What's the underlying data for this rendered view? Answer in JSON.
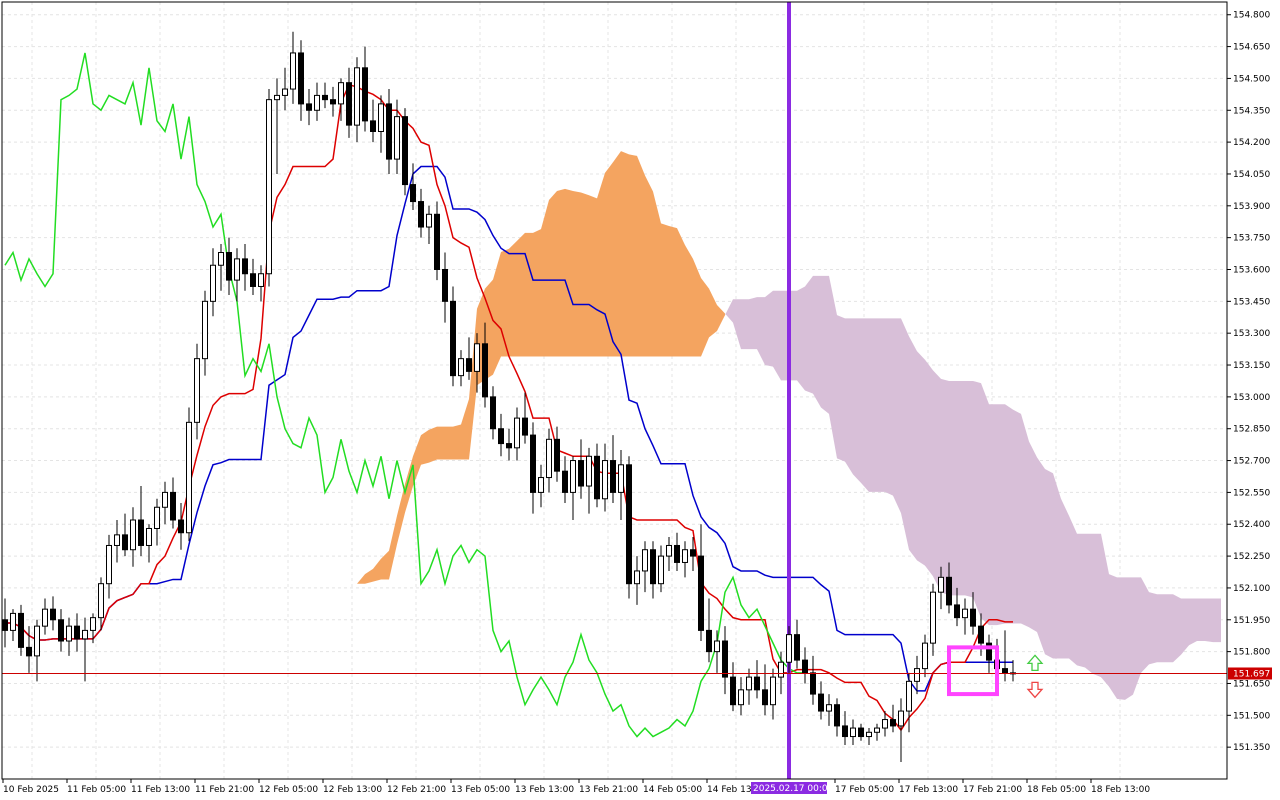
{
  "chart_data": {
    "type": "candlestick",
    "instrument_note": "",
    "y_axis": {
      "range": [
        151.2,
        154.86
      ],
      "ticks": [
        "154.800",
        "154.650",
        "154.500",
        "154.350",
        "154.200",
        "154.050",
        "153.900",
        "153.750",
        "153.600",
        "153.450",
        "153.300",
        "153.150",
        "153.000",
        "152.850",
        "152.700",
        "152.550",
        "152.400",
        "152.250",
        "152.100",
        "151.950",
        "151.800",
        "151.650",
        "151.500",
        "151.350"
      ]
    },
    "x_axis": {
      "labels": [
        "10 Feb 2025",
        "11 Feb 05:00",
        "11 Feb 13:00",
        "11 Feb 21:00",
        "12 Feb 05:00",
        "12 Feb 13:00",
        "12 Feb 21:00",
        "13 Feb 05:00",
        "13 Feb 13:00",
        "13 Feb 21:00",
        "14 Feb 05:00",
        "14 Feb 13:00",
        "17 Feb 05:00",
        "17 Feb 13:00",
        "17 Feb 21:00",
        "18 Feb 05:00",
        "18 Feb 13:00"
      ],
      "highlight_label": "2025.02.17 00:00"
    },
    "current_price": "151.697",
    "current_price_value": 151.697,
    "grid": true,
    "candles": [
      {
        "o": 151.95,
        "h": 152.05,
        "l": 151.82,
        "c": 151.9
      },
      {
        "o": 151.9,
        "h": 152.0,
        "l": 151.85,
        "c": 151.98
      },
      {
        "o": 151.98,
        "h": 152.02,
        "l": 151.78,
        "c": 151.82
      },
      {
        "o": 151.82,
        "h": 151.92,
        "l": 151.7,
        "c": 151.78
      },
      {
        "o": 151.78,
        "h": 151.95,
        "l": 151.66,
        "c": 151.92
      },
      {
        "o": 151.92,
        "h": 152.05,
        "l": 151.88,
        "c": 152.0
      },
      {
        "o": 152.0,
        "h": 152.06,
        "l": 151.9,
        "c": 151.95
      },
      {
        "o": 151.95,
        "h": 152.0,
        "l": 151.8,
        "c": 151.85
      },
      {
        "o": 151.85,
        "h": 151.96,
        "l": 151.78,
        "c": 151.92
      },
      {
        "o": 151.92,
        "h": 151.98,
        "l": 151.8,
        "c": 151.86
      },
      {
        "o": 151.86,
        "h": 151.96,
        "l": 151.66,
        "c": 151.9
      },
      {
        "o": 151.9,
        "h": 151.98,
        "l": 151.84,
        "c": 151.96
      },
      {
        "o": 151.96,
        "h": 152.15,
        "l": 151.9,
        "c": 152.12
      },
      {
        "o": 152.12,
        "h": 152.35,
        "l": 152.05,
        "c": 152.3
      },
      {
        "o": 152.3,
        "h": 152.42,
        "l": 152.22,
        "c": 152.35
      },
      {
        "o": 152.35,
        "h": 152.45,
        "l": 152.25,
        "c": 152.28
      },
      {
        "o": 152.28,
        "h": 152.48,
        "l": 152.2,
        "c": 152.42
      },
      {
        "o": 152.42,
        "h": 152.58,
        "l": 152.25,
        "c": 152.3
      },
      {
        "o": 152.3,
        "h": 152.4,
        "l": 152.22,
        "c": 152.38
      },
      {
        "o": 152.38,
        "h": 152.52,
        "l": 152.3,
        "c": 152.48
      },
      {
        "o": 152.48,
        "h": 152.6,
        "l": 152.4,
        "c": 152.55
      },
      {
        "o": 152.55,
        "h": 152.62,
        "l": 152.38,
        "c": 152.42
      },
      {
        "o": 152.42,
        "h": 152.5,
        "l": 152.28,
        "c": 152.36
      },
      {
        "o": 152.36,
        "h": 152.95,
        "l": 152.32,
        "c": 152.88
      },
      {
        "o": 152.88,
        "h": 153.25,
        "l": 152.8,
        "c": 153.18
      },
      {
        "o": 153.18,
        "h": 153.5,
        "l": 153.1,
        "c": 153.45
      },
      {
        "o": 153.45,
        "h": 153.7,
        "l": 153.38,
        "c": 153.62
      },
      {
        "o": 153.62,
        "h": 153.72,
        "l": 153.5,
        "c": 153.68
      },
      {
        "o": 153.68,
        "h": 153.75,
        "l": 153.48,
        "c": 153.55
      },
      {
        "o": 153.55,
        "h": 153.7,
        "l": 153.45,
        "c": 153.65
      },
      {
        "o": 153.65,
        "h": 153.72,
        "l": 153.5,
        "c": 153.58
      },
      {
        "o": 153.58,
        "h": 153.65,
        "l": 153.48,
        "c": 153.52
      },
      {
        "o": 153.52,
        "h": 153.62,
        "l": 153.45,
        "c": 153.58
      },
      {
        "o": 153.58,
        "h": 154.45,
        "l": 153.52,
        "c": 154.4
      },
      {
        "o": 154.4,
        "h": 154.5,
        "l": 154.05,
        "c": 154.42
      },
      {
        "o": 154.42,
        "h": 154.55,
        "l": 154.35,
        "c": 154.45
      },
      {
        "o": 154.45,
        "h": 154.72,
        "l": 154.38,
        "c": 154.62
      },
      {
        "o": 154.62,
        "h": 154.68,
        "l": 154.3,
        "c": 154.38
      },
      {
        "o": 154.38,
        "h": 154.45,
        "l": 154.28,
        "c": 154.35
      },
      {
        "o": 154.35,
        "h": 154.48,
        "l": 154.3,
        "c": 154.42
      },
      {
        "o": 154.42,
        "h": 154.48,
        "l": 154.36,
        "c": 154.4
      },
      {
        "o": 154.4,
        "h": 154.46,
        "l": 154.32,
        "c": 154.38
      },
      {
        "o": 154.38,
        "h": 154.5,
        "l": 154.3,
        "c": 154.48
      },
      {
        "o": 154.48,
        "h": 154.55,
        "l": 154.22,
        "c": 154.28
      },
      {
        "o": 154.28,
        "h": 154.6,
        "l": 154.2,
        "c": 154.55
      },
      {
        "o": 154.55,
        "h": 154.65,
        "l": 154.25,
        "c": 154.3
      },
      {
        "o": 154.3,
        "h": 154.4,
        "l": 154.2,
        "c": 154.25
      },
      {
        "o": 154.25,
        "h": 154.42,
        "l": 154.15,
        "c": 154.38
      },
      {
        "o": 154.38,
        "h": 154.45,
        "l": 154.05,
        "c": 154.12
      },
      {
        "o": 154.12,
        "h": 154.4,
        "l": 154.05,
        "c": 154.32
      },
      {
        "o": 154.32,
        "h": 154.36,
        "l": 153.95,
        "c": 154.0
      },
      {
        "o": 154.0,
        "h": 154.1,
        "l": 153.88,
        "c": 153.92
      },
      {
        "o": 153.92,
        "h": 153.98,
        "l": 153.75,
        "c": 153.8
      },
      {
        "o": 153.8,
        "h": 153.9,
        "l": 153.72,
        "c": 153.86
      },
      {
        "o": 153.86,
        "h": 153.92,
        "l": 153.55,
        "c": 153.6
      },
      {
        "o": 153.6,
        "h": 153.68,
        "l": 153.35,
        "c": 153.45
      },
      {
        "o": 153.45,
        "h": 153.52,
        "l": 153.05,
        "c": 153.1
      },
      {
        "o": 153.1,
        "h": 153.22,
        "l": 153.05,
        "c": 153.18
      },
      {
        "o": 153.18,
        "h": 153.28,
        "l": 153.08,
        "c": 153.12
      },
      {
        "o": 153.12,
        "h": 153.3,
        "l": 153.02,
        "c": 153.25
      },
      {
        "o": 153.25,
        "h": 153.35,
        "l": 152.95,
        "c": 153.0
      },
      {
        "o": 153.0,
        "h": 153.05,
        "l": 152.8,
        "c": 152.85
      },
      {
        "o": 152.85,
        "h": 152.92,
        "l": 152.72,
        "c": 152.78
      },
      {
        "o": 152.78,
        "h": 152.85,
        "l": 152.7,
        "c": 152.76
      },
      {
        "o": 152.76,
        "h": 152.95,
        "l": 152.7,
        "c": 152.9
      },
      {
        "o": 152.9,
        "h": 153.02,
        "l": 152.78,
        "c": 152.82
      },
      {
        "o": 152.82,
        "h": 152.88,
        "l": 152.45,
        "c": 152.55
      },
      {
        "o": 152.55,
        "h": 152.68,
        "l": 152.48,
        "c": 152.62
      },
      {
        "o": 152.62,
        "h": 152.85,
        "l": 152.55,
        "c": 152.8
      },
      {
        "o": 152.8,
        "h": 152.86,
        "l": 152.6,
        "c": 152.65
      },
      {
        "o": 152.65,
        "h": 152.72,
        "l": 152.5,
        "c": 152.55
      },
      {
        "o": 152.55,
        "h": 152.72,
        "l": 152.42,
        "c": 152.7
      },
      {
        "o": 152.7,
        "h": 152.8,
        "l": 152.52,
        "c": 152.58
      },
      {
        "o": 152.58,
        "h": 152.76,
        "l": 152.45,
        "c": 152.72
      },
      {
        "o": 152.72,
        "h": 152.78,
        "l": 152.48,
        "c": 152.52
      },
      {
        "o": 152.52,
        "h": 152.78,
        "l": 152.46,
        "c": 152.7
      },
      {
        "o": 152.7,
        "h": 152.82,
        "l": 152.5,
        "c": 152.55
      },
      {
        "o": 152.55,
        "h": 152.75,
        "l": 152.42,
        "c": 152.68
      },
      {
        "o": 152.68,
        "h": 152.72,
        "l": 152.05,
        "c": 152.12
      },
      {
        "o": 152.12,
        "h": 152.25,
        "l": 152.02,
        "c": 152.18
      },
      {
        "o": 152.18,
        "h": 152.32,
        "l": 152.08,
        "c": 152.28
      },
      {
        "o": 152.28,
        "h": 152.32,
        "l": 152.05,
        "c": 152.12
      },
      {
        "o": 152.12,
        "h": 152.3,
        "l": 152.08,
        "c": 152.25
      },
      {
        "o": 152.25,
        "h": 152.34,
        "l": 152.18,
        "c": 152.3
      },
      {
        "o": 152.3,
        "h": 152.36,
        "l": 152.18,
        "c": 152.22
      },
      {
        "o": 152.22,
        "h": 152.32,
        "l": 152.15,
        "c": 152.28
      },
      {
        "o": 152.28,
        "h": 152.34,
        "l": 152.18,
        "c": 152.25
      },
      {
        "o": 152.25,
        "h": 152.4,
        "l": 151.85,
        "c": 151.9
      },
      {
        "o": 151.9,
        "h": 152.05,
        "l": 151.75,
        "c": 151.8
      },
      {
        "o": 151.8,
        "h": 151.9,
        "l": 151.7,
        "c": 151.85
      },
      {
        "o": 151.85,
        "h": 151.92,
        "l": 151.6,
        "c": 151.68
      },
      {
        "o": 151.68,
        "h": 151.75,
        "l": 151.52,
        "c": 151.55
      },
      {
        "o": 151.55,
        "h": 151.68,
        "l": 151.5,
        "c": 151.62
      },
      {
        "o": 151.62,
        "h": 151.72,
        "l": 151.55,
        "c": 151.68
      },
      {
        "o": 151.68,
        "h": 151.76,
        "l": 151.58,
        "c": 151.62
      },
      {
        "o": 151.62,
        "h": 151.74,
        "l": 151.5,
        "c": 151.55
      },
      {
        "o": 151.55,
        "h": 151.72,
        "l": 151.48,
        "c": 151.68
      },
      {
        "o": 151.68,
        "h": 151.8,
        "l": 151.6,
        "c": 151.75
      },
      {
        "o": 151.75,
        "h": 151.92,
        "l": 151.7,
        "c": 151.88
      },
      {
        "o": 151.88,
        "h": 151.95,
        "l": 151.72,
        "c": 151.76
      },
      {
        "o": 151.76,
        "h": 151.82,
        "l": 151.65,
        "c": 151.7
      },
      {
        "o": 151.7,
        "h": 151.78,
        "l": 151.55,
        "c": 151.6
      },
      {
        "o": 151.6,
        "h": 151.66,
        "l": 151.48,
        "c": 151.52
      },
      {
        "o": 151.52,
        "h": 151.6,
        "l": 151.45,
        "c": 151.55
      },
      {
        "o": 151.55,
        "h": 151.58,
        "l": 151.4,
        "c": 151.45
      },
      {
        "o": 151.45,
        "h": 151.52,
        "l": 151.36,
        "c": 151.4
      },
      {
        "o": 151.4,
        "h": 151.48,
        "l": 151.36,
        "c": 151.44
      },
      {
        "o": 151.44,
        "h": 151.46,
        "l": 151.38,
        "c": 151.4
      },
      {
        "o": 151.4,
        "h": 151.44,
        "l": 151.36,
        "c": 151.42
      },
      {
        "o": 151.42,
        "h": 151.46,
        "l": 151.38,
        "c": 151.44
      },
      {
        "o": 151.44,
        "h": 151.52,
        "l": 151.4,
        "c": 151.48
      },
      {
        "o": 151.48,
        "h": 151.55,
        "l": 151.42,
        "c": 151.45
      },
      {
        "o": 151.45,
        "h": 151.58,
        "l": 151.28,
        "c": 151.52
      },
      {
        "o": 151.52,
        "h": 151.7,
        "l": 151.42,
        "c": 151.66
      },
      {
        "o": 151.66,
        "h": 151.78,
        "l": 151.6,
        "c": 151.72
      },
      {
        "o": 151.72,
        "h": 151.88,
        "l": 151.68,
        "c": 151.84
      },
      {
        "o": 151.84,
        "h": 152.12,
        "l": 151.78,
        "c": 152.08
      },
      {
        "o": 152.08,
        "h": 152.2,
        "l": 152.0,
        "c": 152.15
      },
      {
        "o": 152.15,
        "h": 152.22,
        "l": 151.98,
        "c": 152.02
      },
      {
        "o": 152.02,
        "h": 152.1,
        "l": 151.92,
        "c": 151.96
      },
      {
        "o": 151.96,
        "h": 152.05,
        "l": 151.88,
        "c": 152.0
      },
      {
        "o": 152.0,
        "h": 152.08,
        "l": 151.88,
        "c": 151.92
      },
      {
        "o": 151.92,
        "h": 151.98,
        "l": 151.78,
        "c": 151.84
      },
      {
        "o": 151.84,
        "h": 151.88,
        "l": 151.7,
        "c": 151.76
      },
      {
        "o": 151.76,
        "h": 151.86,
        "l": 151.68,
        "c": 151.72
      },
      {
        "o": 151.72,
        "h": 151.9,
        "l": 151.66,
        "c": 151.7
      },
      {
        "o": 151.7,
        "h": 151.76,
        "l": 151.66,
        "c": 151.7
      }
    ],
    "signals": {
      "buy_arrow_color": "#44cc44",
      "sell_arrow_color": "#ee4444"
    },
    "colors": {
      "tenkan": "#dd0000",
      "kijun": "#0000cc",
      "chikou": "#22dd22",
      "cloud_bull": "#f4a460",
      "cloud_bear": "#d8bfd8",
      "vline": "#8b2be2",
      "highlight_box": "#ff44ff",
      "price_line": "#cc0000"
    }
  }
}
